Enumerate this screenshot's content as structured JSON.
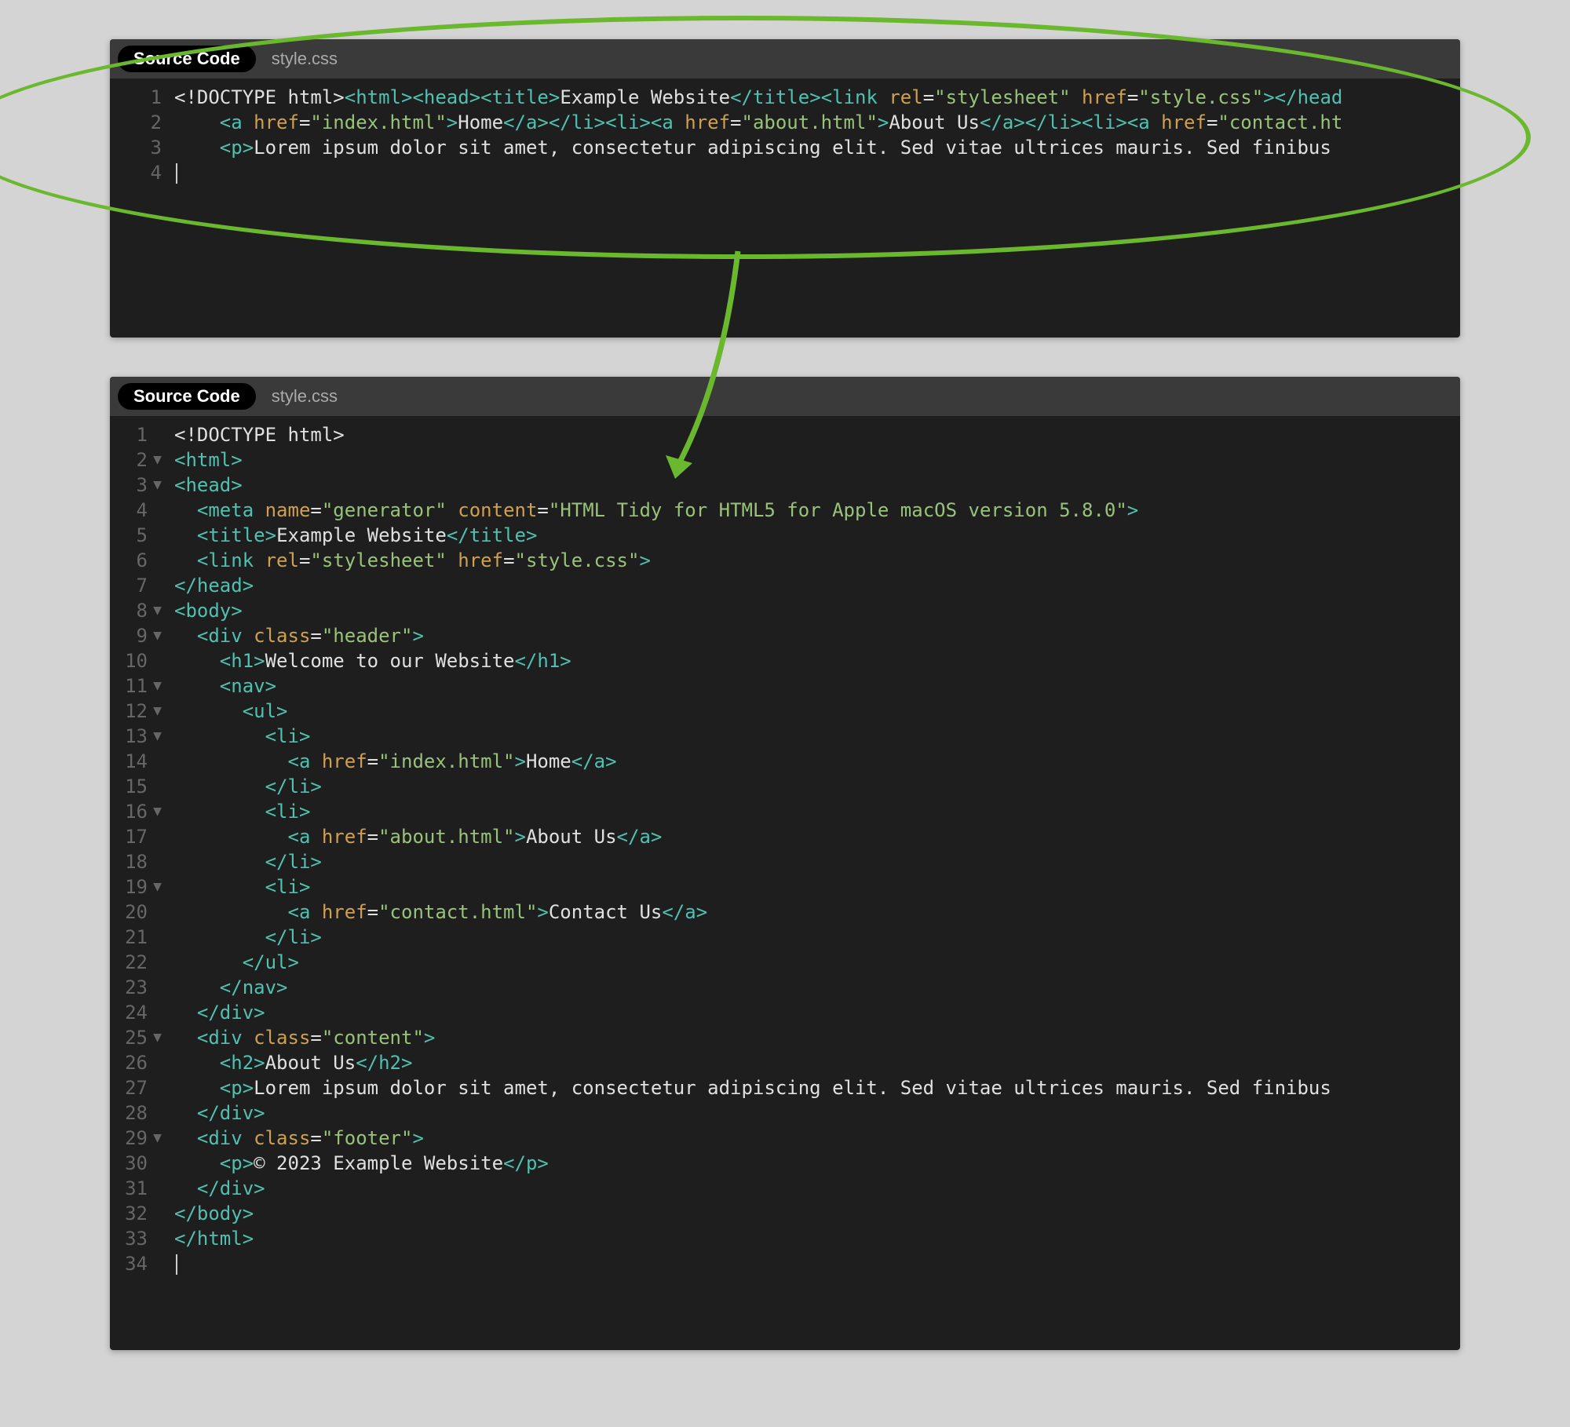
{
  "tabs": {
    "source_code": "Source Code",
    "style_css": "style.css"
  },
  "top_editor": {
    "lines": [
      {
        "num": "1",
        "tokens": [
          {
            "c": "txt",
            "t": "<!DOCTYPE html>"
          },
          {
            "c": "tag",
            "t": "<html>"
          },
          {
            "c": "tag",
            "t": "<head>"
          },
          {
            "c": "tag",
            "t": "<title>"
          },
          {
            "c": "txt",
            "t": "Example Website"
          },
          {
            "c": "tag",
            "t": "</title>"
          },
          {
            "c": "tag",
            "t": "<link "
          },
          {
            "c": "attr",
            "t": "rel"
          },
          {
            "c": "txt",
            "t": "="
          },
          {
            "c": "str",
            "t": "\"stylesheet\""
          },
          {
            "c": "txt",
            "t": " "
          },
          {
            "c": "attr",
            "t": "href"
          },
          {
            "c": "txt",
            "t": "="
          },
          {
            "c": "str",
            "t": "\"style.css\""
          },
          {
            "c": "tag",
            "t": ">"
          },
          {
            "c": "tag",
            "t": "</head"
          }
        ]
      },
      {
        "num": "2",
        "tokens": [
          {
            "c": "txt",
            "t": "    "
          },
          {
            "c": "tag",
            "t": "<a "
          },
          {
            "c": "attr",
            "t": "href"
          },
          {
            "c": "txt",
            "t": "="
          },
          {
            "c": "str",
            "t": "\"index.html\""
          },
          {
            "c": "tag",
            "t": ">"
          },
          {
            "c": "txt",
            "t": "Home"
          },
          {
            "c": "tag",
            "t": "</a>"
          },
          {
            "c": "tag",
            "t": "</li>"
          },
          {
            "c": "tag",
            "t": "<li>"
          },
          {
            "c": "tag",
            "t": "<a "
          },
          {
            "c": "attr",
            "t": "href"
          },
          {
            "c": "txt",
            "t": "="
          },
          {
            "c": "str",
            "t": "\"about.html\""
          },
          {
            "c": "tag",
            "t": ">"
          },
          {
            "c": "txt",
            "t": "About Us"
          },
          {
            "c": "tag",
            "t": "</a>"
          },
          {
            "c": "tag",
            "t": "</li>"
          },
          {
            "c": "tag",
            "t": "<li>"
          },
          {
            "c": "tag",
            "t": "<a "
          },
          {
            "c": "attr",
            "t": "href"
          },
          {
            "c": "txt",
            "t": "="
          },
          {
            "c": "str",
            "t": "\"contact.ht"
          }
        ]
      },
      {
        "num": "3",
        "tokens": [
          {
            "c": "txt",
            "t": "    "
          },
          {
            "c": "tag",
            "t": "<p>"
          },
          {
            "c": "txt",
            "t": "Lorem ipsum dolor sit amet, consectetur adipiscing elit. Sed vitae ultrices mauris. Sed finibus"
          }
        ]
      },
      {
        "num": "4",
        "tokens": [],
        "cursor": true
      }
    ]
  },
  "bottom_editor": {
    "lines": [
      {
        "num": "1",
        "fold": "",
        "tokens": [
          {
            "c": "txt",
            "t": "<!DOCTYPE html>"
          }
        ]
      },
      {
        "num": "2",
        "fold": "▼",
        "tokens": [
          {
            "c": "tag",
            "t": "<html>"
          }
        ]
      },
      {
        "num": "3",
        "fold": "▼",
        "tokens": [
          {
            "c": "tag",
            "t": "<head>"
          }
        ]
      },
      {
        "num": "4",
        "fold": "",
        "tokens": [
          {
            "c": "txt",
            "t": "  "
          },
          {
            "c": "tag",
            "t": "<meta "
          },
          {
            "c": "attr",
            "t": "name"
          },
          {
            "c": "txt",
            "t": "="
          },
          {
            "c": "str",
            "t": "\"generator\""
          },
          {
            "c": "txt",
            "t": " "
          },
          {
            "c": "attr",
            "t": "content"
          },
          {
            "c": "txt",
            "t": "="
          },
          {
            "c": "str",
            "t": "\"HTML Tidy for HTML5 for Apple macOS version 5.8.0\""
          },
          {
            "c": "tag",
            "t": ">"
          }
        ]
      },
      {
        "num": "5",
        "fold": "",
        "tokens": [
          {
            "c": "txt",
            "t": "  "
          },
          {
            "c": "tag",
            "t": "<title>"
          },
          {
            "c": "txt",
            "t": "Example Website"
          },
          {
            "c": "tag",
            "t": "</title>"
          }
        ]
      },
      {
        "num": "6",
        "fold": "",
        "tokens": [
          {
            "c": "txt",
            "t": "  "
          },
          {
            "c": "tag",
            "t": "<link "
          },
          {
            "c": "attr",
            "t": "rel"
          },
          {
            "c": "txt",
            "t": "="
          },
          {
            "c": "str",
            "t": "\"stylesheet\""
          },
          {
            "c": "txt",
            "t": " "
          },
          {
            "c": "attr",
            "t": "href"
          },
          {
            "c": "txt",
            "t": "="
          },
          {
            "c": "str",
            "t": "\"style.css\""
          },
          {
            "c": "tag",
            "t": ">"
          }
        ]
      },
      {
        "num": "7",
        "fold": "",
        "tokens": [
          {
            "c": "tag",
            "t": "</head>"
          }
        ]
      },
      {
        "num": "8",
        "fold": "▼",
        "tokens": [
          {
            "c": "tag",
            "t": "<body>"
          }
        ]
      },
      {
        "num": "9",
        "fold": "▼",
        "tokens": [
          {
            "c": "txt",
            "t": "  "
          },
          {
            "c": "tag",
            "t": "<div "
          },
          {
            "c": "attr",
            "t": "class"
          },
          {
            "c": "txt",
            "t": "="
          },
          {
            "c": "str",
            "t": "\"header\""
          },
          {
            "c": "tag",
            "t": ">"
          }
        ]
      },
      {
        "num": "10",
        "fold": "",
        "tokens": [
          {
            "c": "txt",
            "t": "    "
          },
          {
            "c": "tag",
            "t": "<h1>"
          },
          {
            "c": "txt",
            "t": "Welcome to our Website"
          },
          {
            "c": "tag",
            "t": "</h1>"
          }
        ]
      },
      {
        "num": "11",
        "fold": "▼",
        "tokens": [
          {
            "c": "txt",
            "t": "    "
          },
          {
            "c": "tag",
            "t": "<nav>"
          }
        ]
      },
      {
        "num": "12",
        "fold": "▼",
        "tokens": [
          {
            "c": "txt",
            "t": "      "
          },
          {
            "c": "tag",
            "t": "<ul>"
          }
        ]
      },
      {
        "num": "13",
        "fold": "▼",
        "tokens": [
          {
            "c": "txt",
            "t": "        "
          },
          {
            "c": "tag",
            "t": "<li>"
          }
        ]
      },
      {
        "num": "14",
        "fold": "",
        "tokens": [
          {
            "c": "txt",
            "t": "          "
          },
          {
            "c": "tag",
            "t": "<a "
          },
          {
            "c": "attr",
            "t": "href"
          },
          {
            "c": "txt",
            "t": "="
          },
          {
            "c": "str",
            "t": "\"index.html\""
          },
          {
            "c": "tag",
            "t": ">"
          },
          {
            "c": "txt",
            "t": "Home"
          },
          {
            "c": "tag",
            "t": "</a>"
          }
        ]
      },
      {
        "num": "15",
        "fold": "",
        "tokens": [
          {
            "c": "txt",
            "t": "        "
          },
          {
            "c": "tag",
            "t": "</li>"
          }
        ]
      },
      {
        "num": "16",
        "fold": "▼",
        "tokens": [
          {
            "c": "txt",
            "t": "        "
          },
          {
            "c": "tag",
            "t": "<li>"
          }
        ]
      },
      {
        "num": "17",
        "fold": "",
        "tokens": [
          {
            "c": "txt",
            "t": "          "
          },
          {
            "c": "tag",
            "t": "<a "
          },
          {
            "c": "attr",
            "t": "href"
          },
          {
            "c": "txt",
            "t": "="
          },
          {
            "c": "str",
            "t": "\"about.html\""
          },
          {
            "c": "tag",
            "t": ">"
          },
          {
            "c": "txt",
            "t": "About Us"
          },
          {
            "c": "tag",
            "t": "</a>"
          }
        ]
      },
      {
        "num": "18",
        "fold": "",
        "tokens": [
          {
            "c": "txt",
            "t": "        "
          },
          {
            "c": "tag",
            "t": "</li>"
          }
        ]
      },
      {
        "num": "19",
        "fold": "▼",
        "tokens": [
          {
            "c": "txt",
            "t": "        "
          },
          {
            "c": "tag",
            "t": "<li>"
          }
        ]
      },
      {
        "num": "20",
        "fold": "",
        "tokens": [
          {
            "c": "txt",
            "t": "          "
          },
          {
            "c": "tag",
            "t": "<a "
          },
          {
            "c": "attr",
            "t": "href"
          },
          {
            "c": "txt",
            "t": "="
          },
          {
            "c": "str",
            "t": "\"contact.html\""
          },
          {
            "c": "tag",
            "t": ">"
          },
          {
            "c": "txt",
            "t": "Contact Us"
          },
          {
            "c": "tag",
            "t": "</a>"
          }
        ]
      },
      {
        "num": "21",
        "fold": "",
        "tokens": [
          {
            "c": "txt",
            "t": "        "
          },
          {
            "c": "tag",
            "t": "</li>"
          }
        ]
      },
      {
        "num": "22",
        "fold": "",
        "tokens": [
          {
            "c": "txt",
            "t": "      "
          },
          {
            "c": "tag",
            "t": "</ul>"
          }
        ]
      },
      {
        "num": "23",
        "fold": "",
        "tokens": [
          {
            "c": "txt",
            "t": "    "
          },
          {
            "c": "tag",
            "t": "</nav>"
          }
        ]
      },
      {
        "num": "24",
        "fold": "",
        "tokens": [
          {
            "c": "txt",
            "t": "  "
          },
          {
            "c": "tag",
            "t": "</div>"
          }
        ]
      },
      {
        "num": "25",
        "fold": "▼",
        "tokens": [
          {
            "c": "txt",
            "t": "  "
          },
          {
            "c": "tag",
            "t": "<div "
          },
          {
            "c": "attr",
            "t": "class"
          },
          {
            "c": "txt",
            "t": "="
          },
          {
            "c": "str",
            "t": "\"content\""
          },
          {
            "c": "tag",
            "t": ">"
          }
        ]
      },
      {
        "num": "26",
        "fold": "",
        "tokens": [
          {
            "c": "txt",
            "t": "    "
          },
          {
            "c": "tag",
            "t": "<h2>"
          },
          {
            "c": "txt",
            "t": "About Us"
          },
          {
            "c": "tag",
            "t": "</h2>"
          }
        ]
      },
      {
        "num": "27",
        "fold": "",
        "tokens": [
          {
            "c": "txt",
            "t": "    "
          },
          {
            "c": "tag",
            "t": "<p>"
          },
          {
            "c": "txt",
            "t": "Lorem ipsum dolor sit amet, consectetur adipiscing elit. Sed vitae ultrices mauris. Sed finibus"
          }
        ]
      },
      {
        "num": "28",
        "fold": "",
        "tokens": [
          {
            "c": "txt",
            "t": "  "
          },
          {
            "c": "tag",
            "t": "</div>"
          }
        ]
      },
      {
        "num": "29",
        "fold": "▼",
        "tokens": [
          {
            "c": "txt",
            "t": "  "
          },
          {
            "c": "tag",
            "t": "<div "
          },
          {
            "c": "attr",
            "t": "class"
          },
          {
            "c": "txt",
            "t": "="
          },
          {
            "c": "str",
            "t": "\"footer\""
          },
          {
            "c": "tag",
            "t": ">"
          }
        ]
      },
      {
        "num": "30",
        "fold": "",
        "tokens": [
          {
            "c": "txt",
            "t": "    "
          },
          {
            "c": "tag",
            "t": "<p>"
          },
          {
            "c": "txt",
            "t": "© 2023 Example Website"
          },
          {
            "c": "tag",
            "t": "</p>"
          }
        ]
      },
      {
        "num": "31",
        "fold": "",
        "tokens": [
          {
            "c": "txt",
            "t": "  "
          },
          {
            "c": "tag",
            "t": "</div>"
          }
        ]
      },
      {
        "num": "32",
        "fold": "",
        "tokens": [
          {
            "c": "tag",
            "t": "</body>"
          }
        ]
      },
      {
        "num": "33",
        "fold": "",
        "tokens": [
          {
            "c": "tag",
            "t": "</html>"
          }
        ]
      },
      {
        "num": "34",
        "fold": "",
        "tokens": [],
        "cursor": true
      }
    ]
  },
  "annotation": {
    "color": "#6ab82e"
  }
}
